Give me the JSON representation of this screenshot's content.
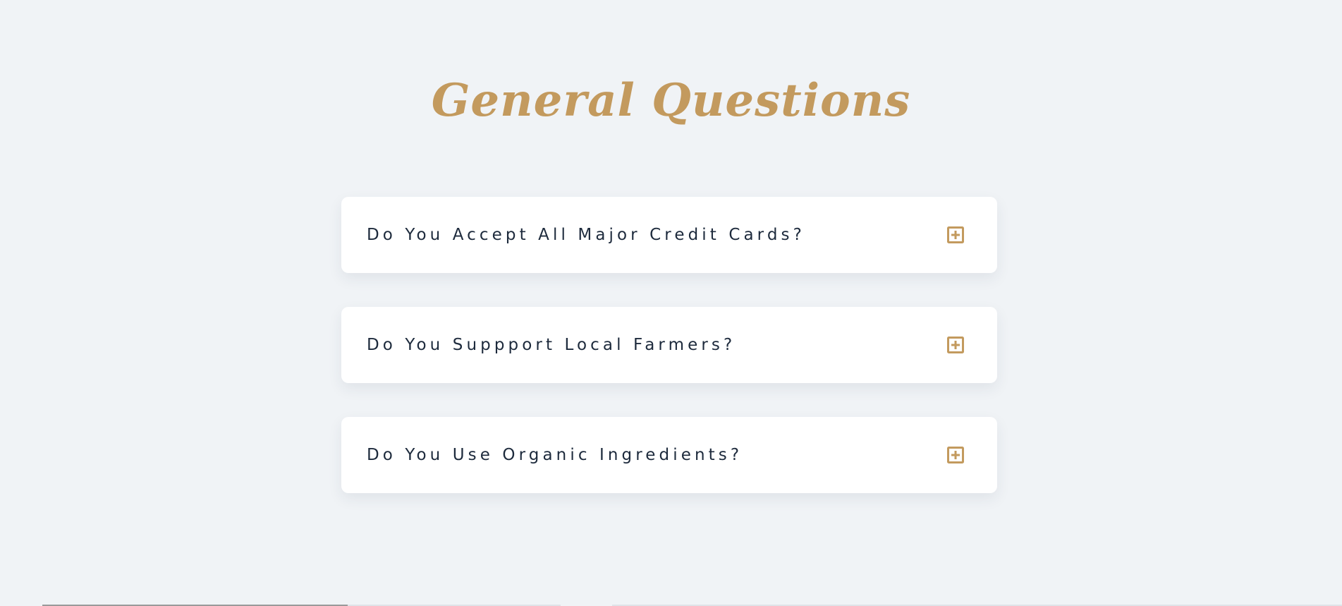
{
  "section": {
    "title": "General Questions"
  },
  "faq": {
    "items": [
      {
        "question": "Do You Accept All Major Credit Cards?",
        "icon": "plus-square-icon"
      },
      {
        "question": "Do You Suppport Local Farmers?",
        "icon": "plus-square-icon"
      },
      {
        "question": "Do You Use Organic Ingredients?",
        "icon": "plus-square-icon"
      }
    ]
  },
  "colors": {
    "accent": "#c39a5e",
    "background": "#f0f3f6",
    "card": "#ffffff",
    "text": "#1d2a3c"
  }
}
